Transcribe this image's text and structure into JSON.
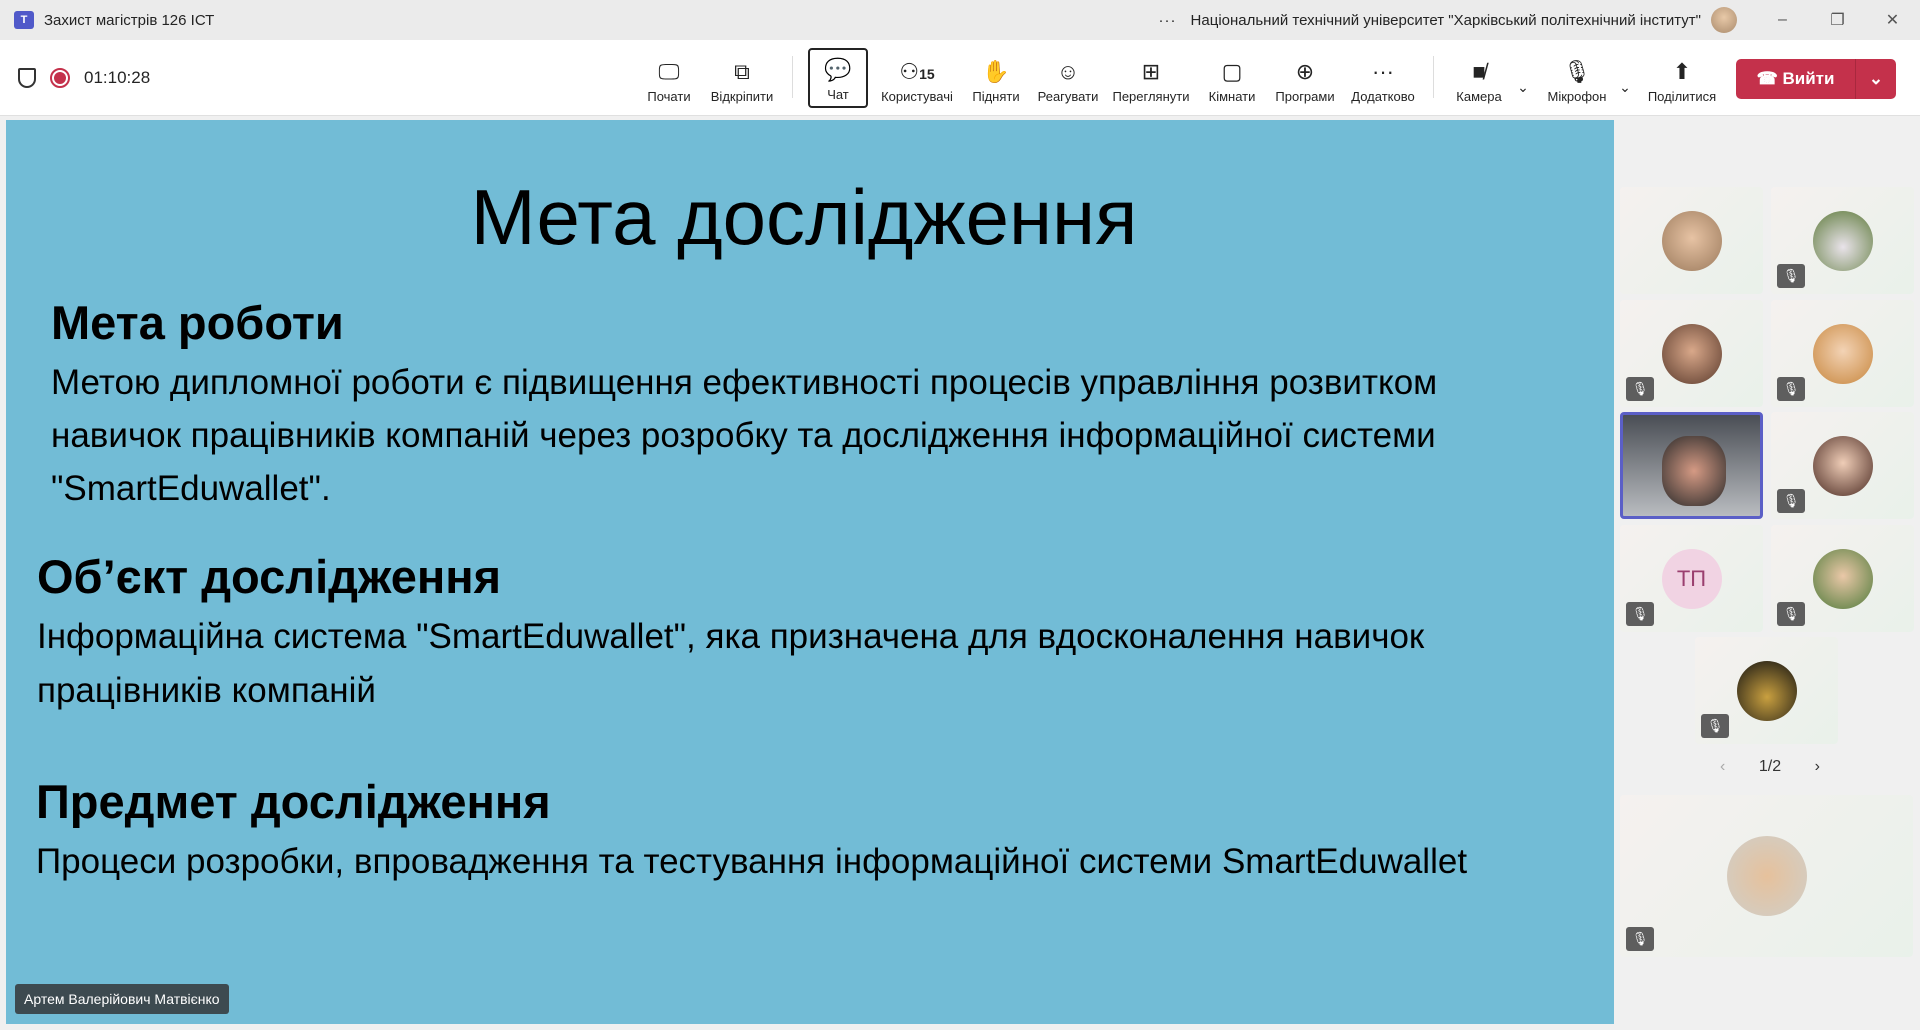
{
  "window": {
    "title": "Захист магістрів 126 ІСТ",
    "org": "Національний технічний університет \"Харківський політехнічний інститут\"",
    "minimize": "–",
    "restore": "❐",
    "close": "✕",
    "more": "···"
  },
  "toolbar": {
    "timer": "01:10:28",
    "participants_count": "15",
    "buttons": [
      {
        "label": "Почати",
        "icon": "share-screen-icon"
      },
      {
        "label": "Відкріпити",
        "icon": "pop-out-icon"
      },
      {
        "label": "Чат",
        "icon": "chat-icon"
      },
      {
        "label": "Користувачі",
        "icon": "people-icon"
      },
      {
        "label": "Підняти",
        "icon": "raise-hand-icon"
      },
      {
        "label": "Реагувати",
        "icon": "react-icon"
      },
      {
        "label": "Переглянути",
        "icon": "view-icon"
      },
      {
        "label": "Кімнати",
        "icon": "rooms-icon"
      },
      {
        "label": "Програми",
        "icon": "apps-icon"
      },
      {
        "label": "Додатково",
        "icon": "more-icon"
      },
      {
        "label": "Камера",
        "icon": "camera-off-icon"
      },
      {
        "label": "Мікрофон",
        "icon": "mic-off-icon"
      },
      {
        "label": "Поділитися",
        "icon": "share-icon"
      }
    ],
    "leave": "Вийти"
  },
  "slide": {
    "title": "Мета дослідження",
    "sections": [
      {
        "heading": "Мета роботи",
        "lines": [
          "Метою дипломної роботи є підвищення ефективності процесів управління розвитком",
          "навичок працівників компаній через розробку та дослідження інформаційної системи",
          "\"SmartEduwallet\"."
        ]
      },
      {
        "heading": "Об’єкт дослідження",
        "lines": [
          "Інформаційна система \"SmartEduwallet\", яка призначена для вдосконалення навичок",
          "працівників компаній"
        ]
      },
      {
        "heading": "Предмет дослідження",
        "lines": [
          "Процеси розробки, впровадження та тестування інформаційної системи SmartEduwallet"
        ]
      }
    ]
  },
  "presenter": "Артем Валерійович Матвієнко",
  "gallery": {
    "initials": "ТП",
    "pager": "1/2",
    "prev": "‹",
    "next": "›"
  }
}
